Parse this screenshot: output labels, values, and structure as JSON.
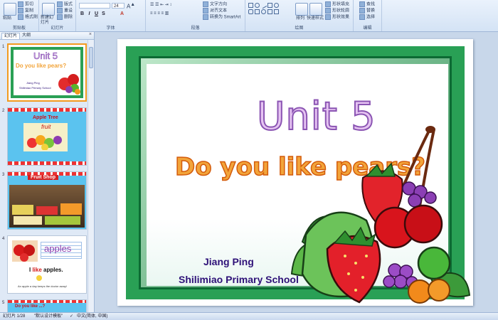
{
  "ribbon": {
    "clipboard": {
      "label": "剪贴板",
      "paste": "粘贴",
      "cut": "剪切",
      "copy": "复制",
      "format_painter": "格式刷"
    },
    "slides": {
      "label": "幻灯片",
      "new_slide": "新建幻灯片",
      "layout": "版式",
      "reset": "重设",
      "delete": "删除"
    },
    "font": {
      "label": "字体",
      "font_name": "",
      "font_size": "24",
      "bold": "B",
      "italic": "I",
      "underline": "U",
      "strike": "S"
    },
    "paragraph": {
      "label": "段落",
      "text_direction": "文字方向",
      "align_text": "对齐文本",
      "smartart": "转换为 SmartArt"
    },
    "drawing": {
      "label": "绘图",
      "arrange": "排列",
      "quick_styles": "快速样式",
      "shape_fill": "形状填充",
      "shape_outline": "形状轮廓",
      "shape_effects": "形状效果"
    },
    "editing": {
      "label": "编辑",
      "find": "查找",
      "replace": "替换",
      "select": "选择"
    }
  },
  "pane": {
    "tab_slides": "幻灯片",
    "tab_outline": "大纲",
    "close": "×",
    "slides": [
      {
        "num": "1",
        "title": "Unit 5",
        "subtitle": "Do you like pears?",
        "author": "Jiang Ping",
        "school": "Shilimiao Primary School"
      },
      {
        "num": "2",
        "title": "Apple Tree",
        "word": "fruit"
      },
      {
        "num": "3",
        "title": "Fruit Shop"
      },
      {
        "num": "4",
        "word": "apples",
        "sentence_pre": "I ",
        "sentence_like": "like",
        "sentence_obj": " apples",
        "sentence_end": ".",
        "caption": "An apple a day keeps the doctor away!"
      },
      {
        "num": "5",
        "text": "Do you like ...?"
      }
    ]
  },
  "slide": {
    "title": "Unit 5",
    "subtitle": "Do you like pears?",
    "author": "Jiang Ping",
    "school": "Shilimiao Primary School"
  },
  "status": {
    "slide_info": "幻灯片 1/28",
    "theme": "\"默认设计模板\"",
    "language": "中文(简体, 中国)"
  },
  "colors": {
    "frame_green": "#29a055",
    "title_purple": "#8b55b3",
    "subtitle_orange": "#f2a43a",
    "author_blue": "#2e1178",
    "selection_orange": "#f29b1f"
  }
}
